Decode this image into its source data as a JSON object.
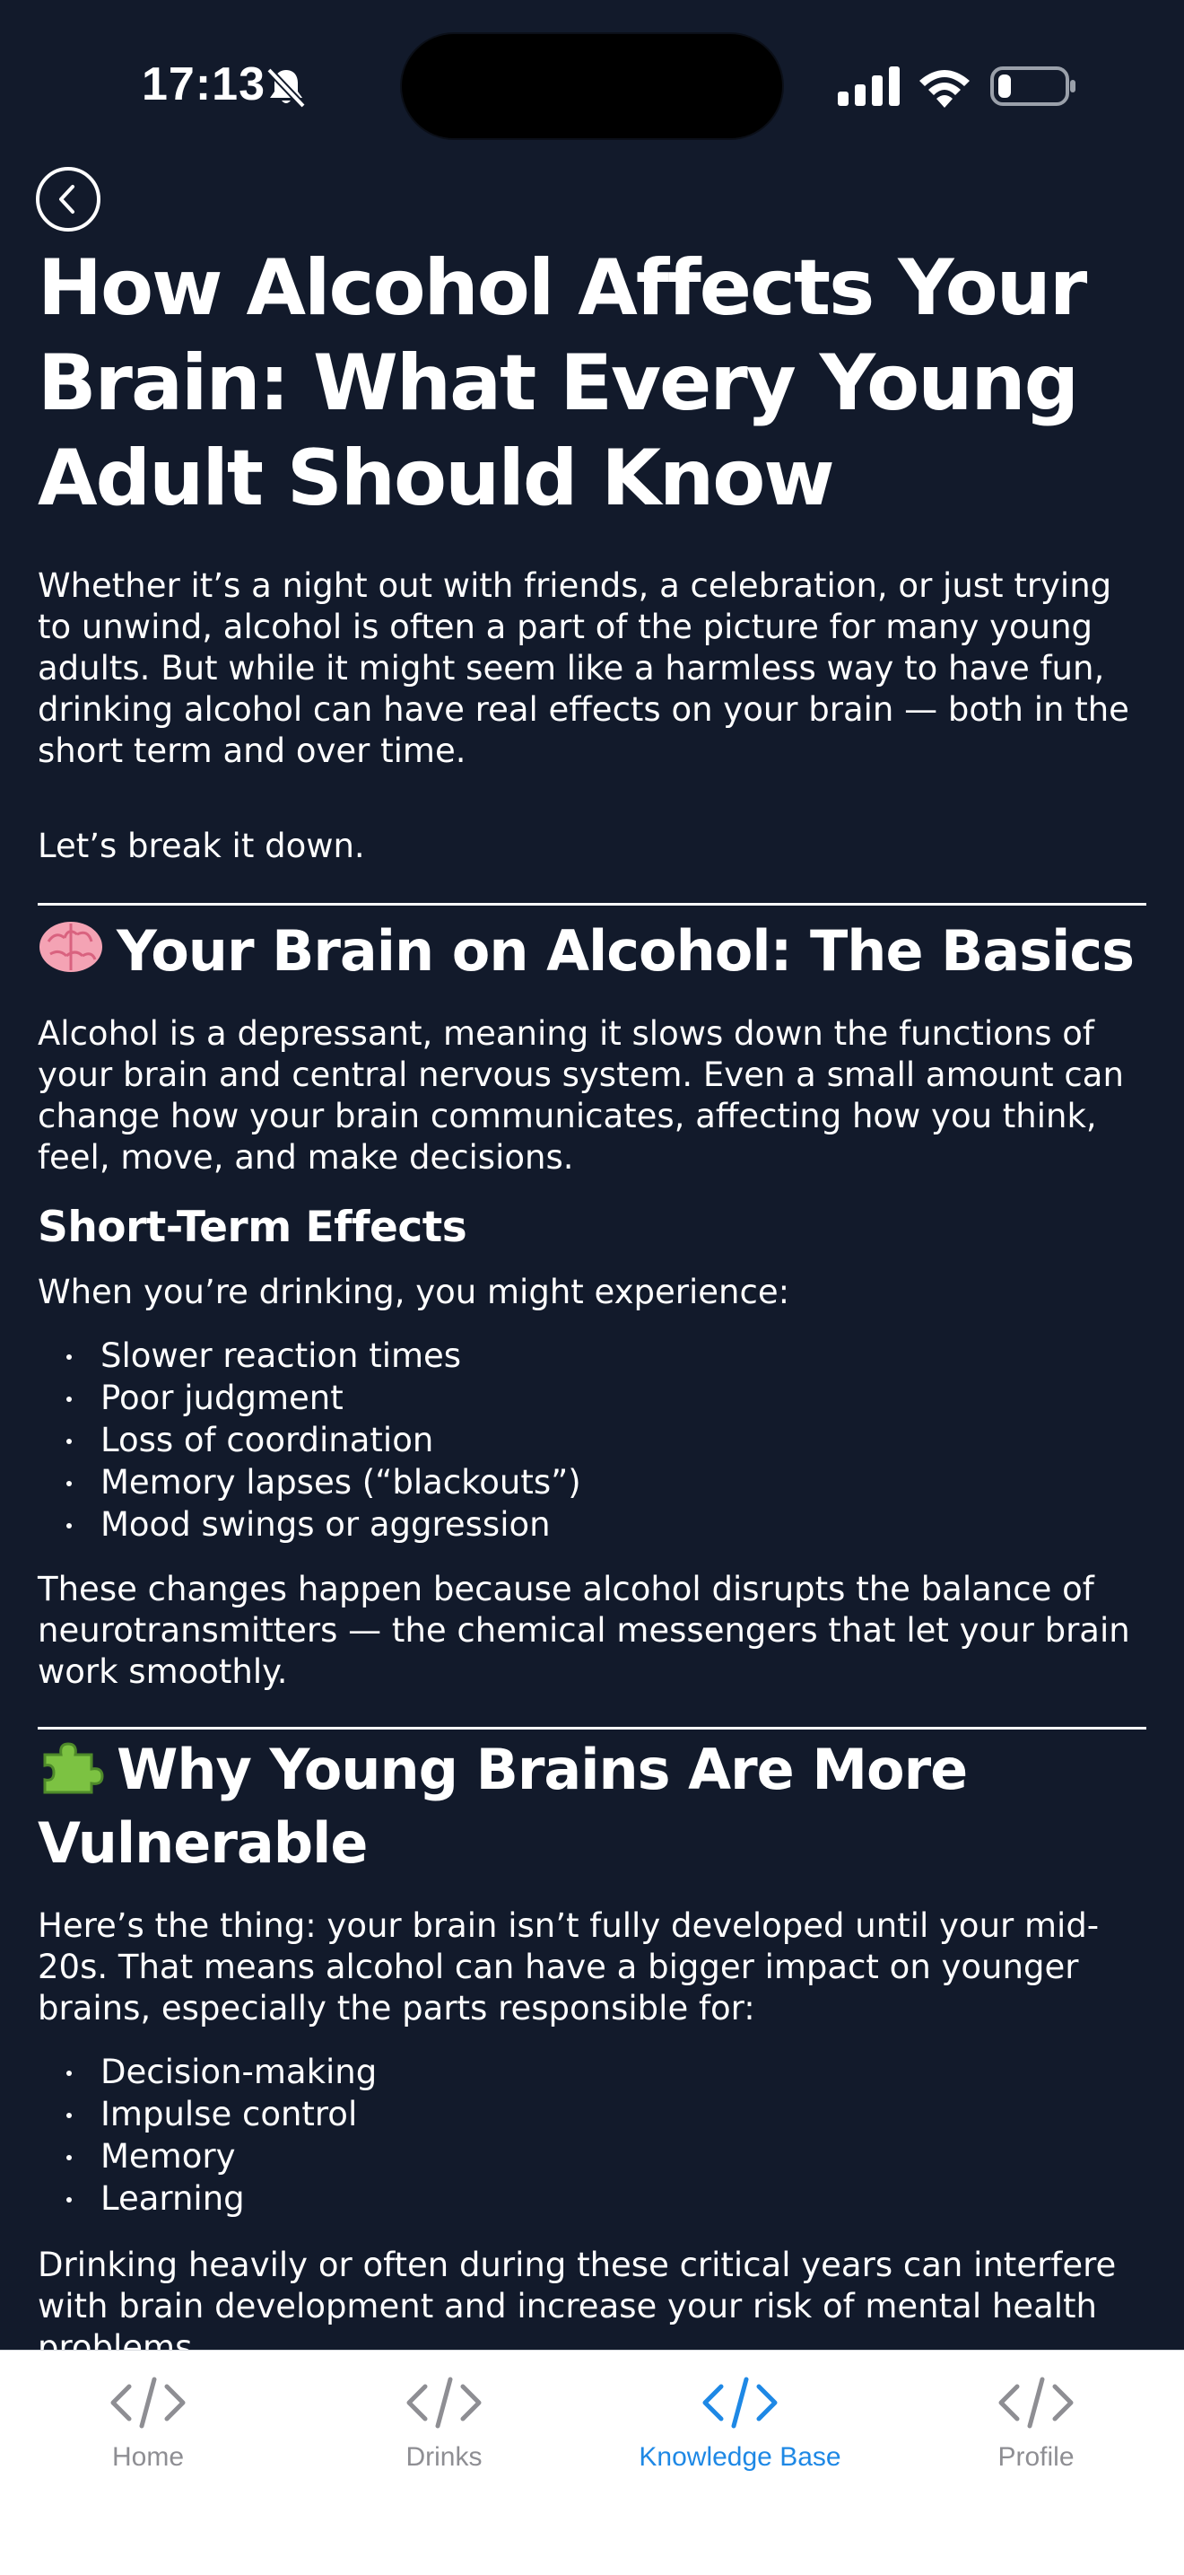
{
  "status_bar": {
    "time": "17:13",
    "icons": [
      "bell-slash-icon",
      "cellular-signal-icon",
      "wifi-icon",
      "battery-icon"
    ]
  },
  "header": {
    "back_icon": "chevron-left-circle-icon"
  },
  "article": {
    "title": "How Alcohol Affects Your Brain: What Every Young Adult Should Know",
    "intro": "Whether it’s a night out with friends, a celebration, or just trying to unwind, alcohol is often a part of the picture for many young adults. But while it might seem like a harmless way to have fun, drinking alcohol can have real effects on your brain — both in the short term and over time.",
    "breakdown": "Let’s break it down.",
    "section1": {
      "emoji": "brain-emoji",
      "heading": "Your Brain on Alcohol: The Basics",
      "paragraph": "Alcohol is a depressant, meaning it slows down the functions of your brain and central nervous system. Even a small amount can change how your brain communicates, affecting how you think, feel, move, and make decisions.",
      "subheading": "Short-Term Effects",
      "lead": "When you’re drinking, you might experience:",
      "bullets": [
        "Slower reaction times",
        "Poor judgment",
        "Loss of coordination",
        "Memory lapses (“blackouts”)",
        "Mood swings or aggression"
      ],
      "closing": "These changes happen because alcohol disrupts the balance of neurotransmitters — the chemical messengers that let your brain work smoothly."
    },
    "section2": {
      "emoji": "puzzle-piece-emoji",
      "heading": "Why Young Brains Are More Vulnerable",
      "paragraph": "Here’s the thing: your brain isn’t fully developed until your mid-20s. That means alcohol can have a bigger impact on younger brains, especially the parts responsible for:",
      "bullets": [
        "Decision-making",
        "Impulse control",
        "Memory",
        "Learning"
      ],
      "closing": "Drinking heavily or often during these critical years can interfere with brain development and increase your risk of mental health problems"
    }
  },
  "tab_bar": {
    "tabs": [
      {
        "label": "Home",
        "icon": "code-icon",
        "active": false
      },
      {
        "label": "Drinks",
        "icon": "code-icon",
        "active": false
      },
      {
        "label": "Knowledge Base",
        "icon": "code-icon",
        "active": true
      },
      {
        "label": "Profile",
        "icon": "code-icon",
        "active": false
      }
    ],
    "active_color": "#1e88e5",
    "inactive_color": "#8e8e93"
  },
  "colors": {
    "background": "#121a2b",
    "text": "#ffffff"
  }
}
